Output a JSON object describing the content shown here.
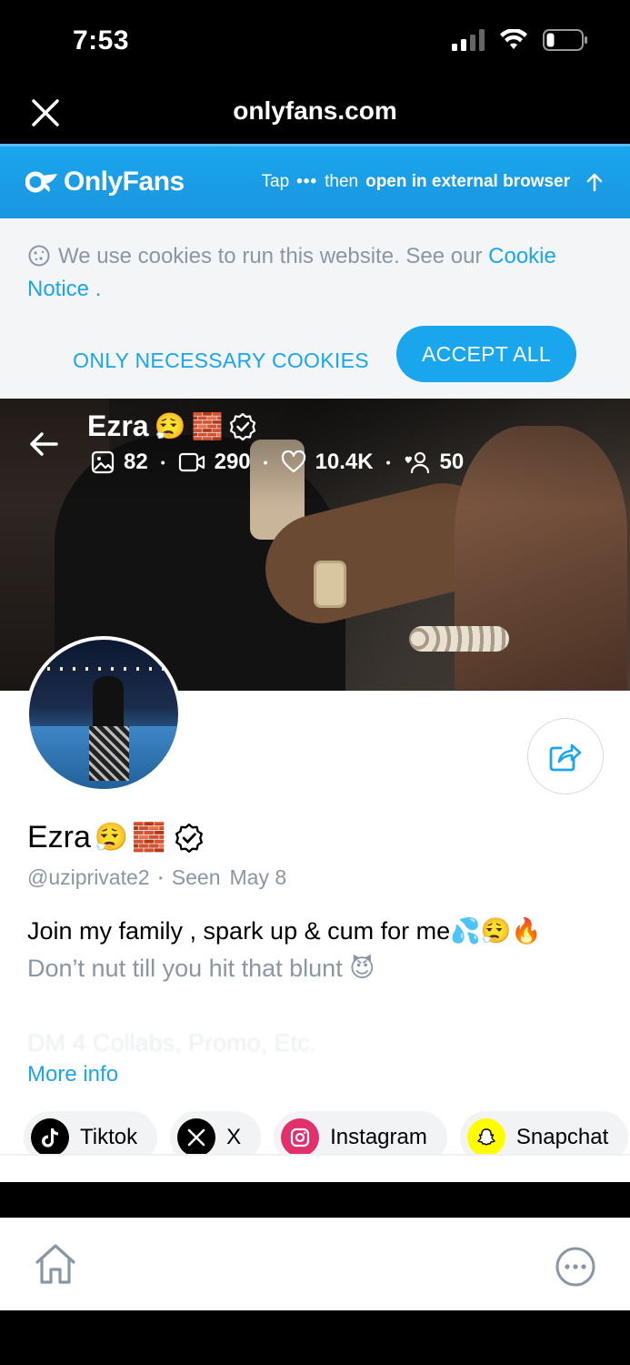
{
  "status_bar": {
    "time": "7:53"
  },
  "browser": {
    "url": "onlyfans.com"
  },
  "banner": {
    "logo_text": "OnlyFans",
    "hint_tap": "Tap",
    "hint_then": "then",
    "hint_action": "open in external browser"
  },
  "cookie": {
    "text": "We use cookies to run this website. See our",
    "link1": "Cookie",
    "link2": "Notice",
    "period": " .",
    "btn_necessary": "ONLY NECESSARY COOKIES",
    "btn_accept": "ACCEPT ALL"
  },
  "cover": {
    "name": "Ezra",
    "stats": {
      "photos": "82",
      "videos": "290",
      "likes": "10.4K",
      "fans": "50"
    }
  },
  "profile": {
    "name": "Ezra",
    "handle": "@uziprivate2",
    "seen_label": "Seen",
    "seen_date": "May 8",
    "bio_line1": "Join my family , spark up & cum for me",
    "bio_line2": "Don’t nut till you hit that blunt",
    "bio_line3": "DM 4 Collabs, Promo, Etc.",
    "more_info": "More info"
  },
  "socials": [
    {
      "label": "Tiktok",
      "icon": "tiktok-icon",
      "color": "#000000"
    },
    {
      "label": "X",
      "icon": "x-icon",
      "color": "#000000"
    },
    {
      "label": "Instagram",
      "icon": "instagram-icon",
      "color": "#e1306c"
    },
    {
      "label": "Snapchat",
      "icon": "snapchat-icon",
      "color": "#fffc00"
    }
  ],
  "colors": {
    "accent": "#1aa6ec",
    "muted": "#8a96a3"
  }
}
